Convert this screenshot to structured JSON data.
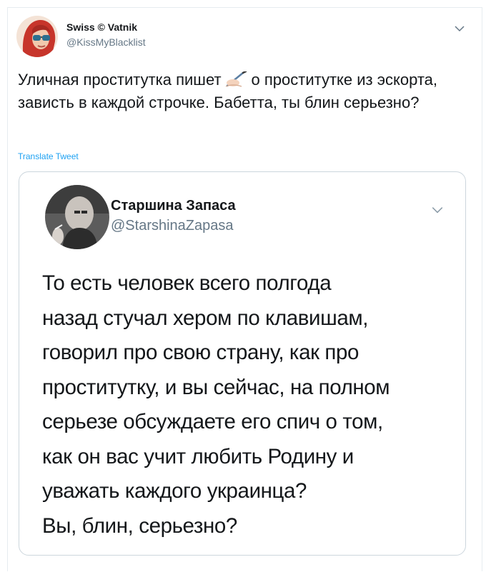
{
  "tweet": {
    "author_name": "Swiss © Vatnik",
    "author_handle": "@KissMyBlacklist",
    "text_before_icon": "Уличная проститутка пишет",
    "text_after_icon": "о проститутке из эскорта, зависть в каждой строчке. Бабетта, ты блин серьезно?",
    "inline_icon": "writing-hand-emoji",
    "translate_label": "Translate Tweet",
    "menu_icon": "chevron-down-icon"
  },
  "quoted_tweet": {
    "author_name": "Старшина Запаса",
    "author_handle": "@StarshinaZapasa",
    "menu_icon": "chevron-down-icon",
    "lines": [
      "То есть человек всего полгода",
      "назад стучал хером по клавишам,",
      "говорил про свою страну, как про",
      "проститутку, и вы сейчас, на полном",
      "серьезе обсуждаете его спич о том,",
      "как он вас учит любить Родину и",
      "уважать каждого украинца?",
      "Вы, блин, серьезно?"
    ]
  },
  "colors": {
    "text": "#14171a",
    "secondary": "#657786",
    "link": "#1da1f2",
    "border": "#ccd6dd"
  }
}
